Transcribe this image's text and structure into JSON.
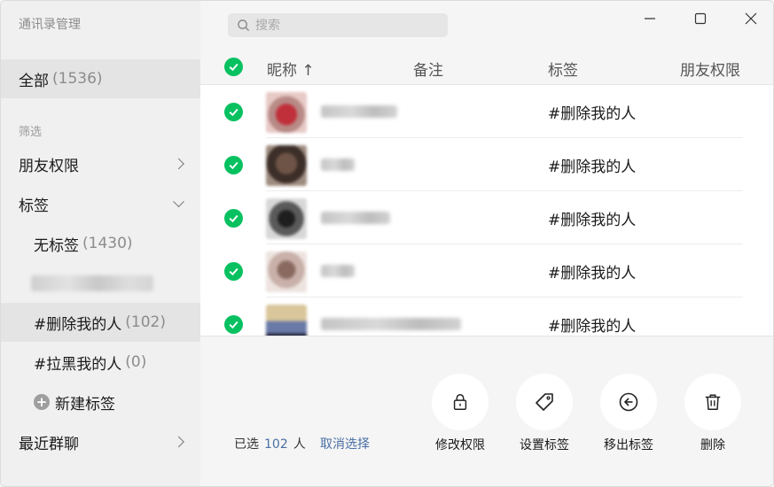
{
  "app": {
    "title": "通讯录管理"
  },
  "sidebar": {
    "all": {
      "label": "全部",
      "count": "(1536)"
    },
    "filter_label": "筛选",
    "friend_permission": "朋友权限",
    "tags_label": "标签",
    "tag_items": [
      {
        "label": "无标签",
        "count": "(1430)"
      },
      {
        "label": "",
        "count": ""
      },
      {
        "label": "#删除我的人",
        "count": "(102)"
      },
      {
        "label": "#拉黑我的人",
        "count": "(0)"
      }
    ],
    "new_tag": "新建标签",
    "recent_groups": "最近群聊"
  },
  "search": {
    "placeholder": "搜索"
  },
  "list": {
    "columns": {
      "nickname": "昵称 ↑",
      "remark": "备注",
      "tag": "标签",
      "permission": "朋友权限"
    },
    "rows": [
      {
        "tag": "#删除我的人"
      },
      {
        "tag": "#删除我的人"
      },
      {
        "tag": "#删除我的人"
      },
      {
        "tag": "#删除我的人"
      },
      {
        "tag": "#删除我的人"
      }
    ]
  },
  "footer": {
    "selected_prefix": "已选",
    "selected_count": "102",
    "selected_suffix": "人",
    "cancel_selection": "取消选择",
    "actions": [
      {
        "label": "修改权限",
        "icon": "lock-icon"
      },
      {
        "label": "设置标签",
        "icon": "tag-icon"
      },
      {
        "label": "移出标签",
        "icon": "arrow-left-circle-icon"
      },
      {
        "label": "删除",
        "icon": "trash-icon"
      }
    ]
  },
  "colors": {
    "accent_green": "#07c160",
    "link_blue": "#4a6fa5",
    "active_row": "#e4e4e4"
  }
}
